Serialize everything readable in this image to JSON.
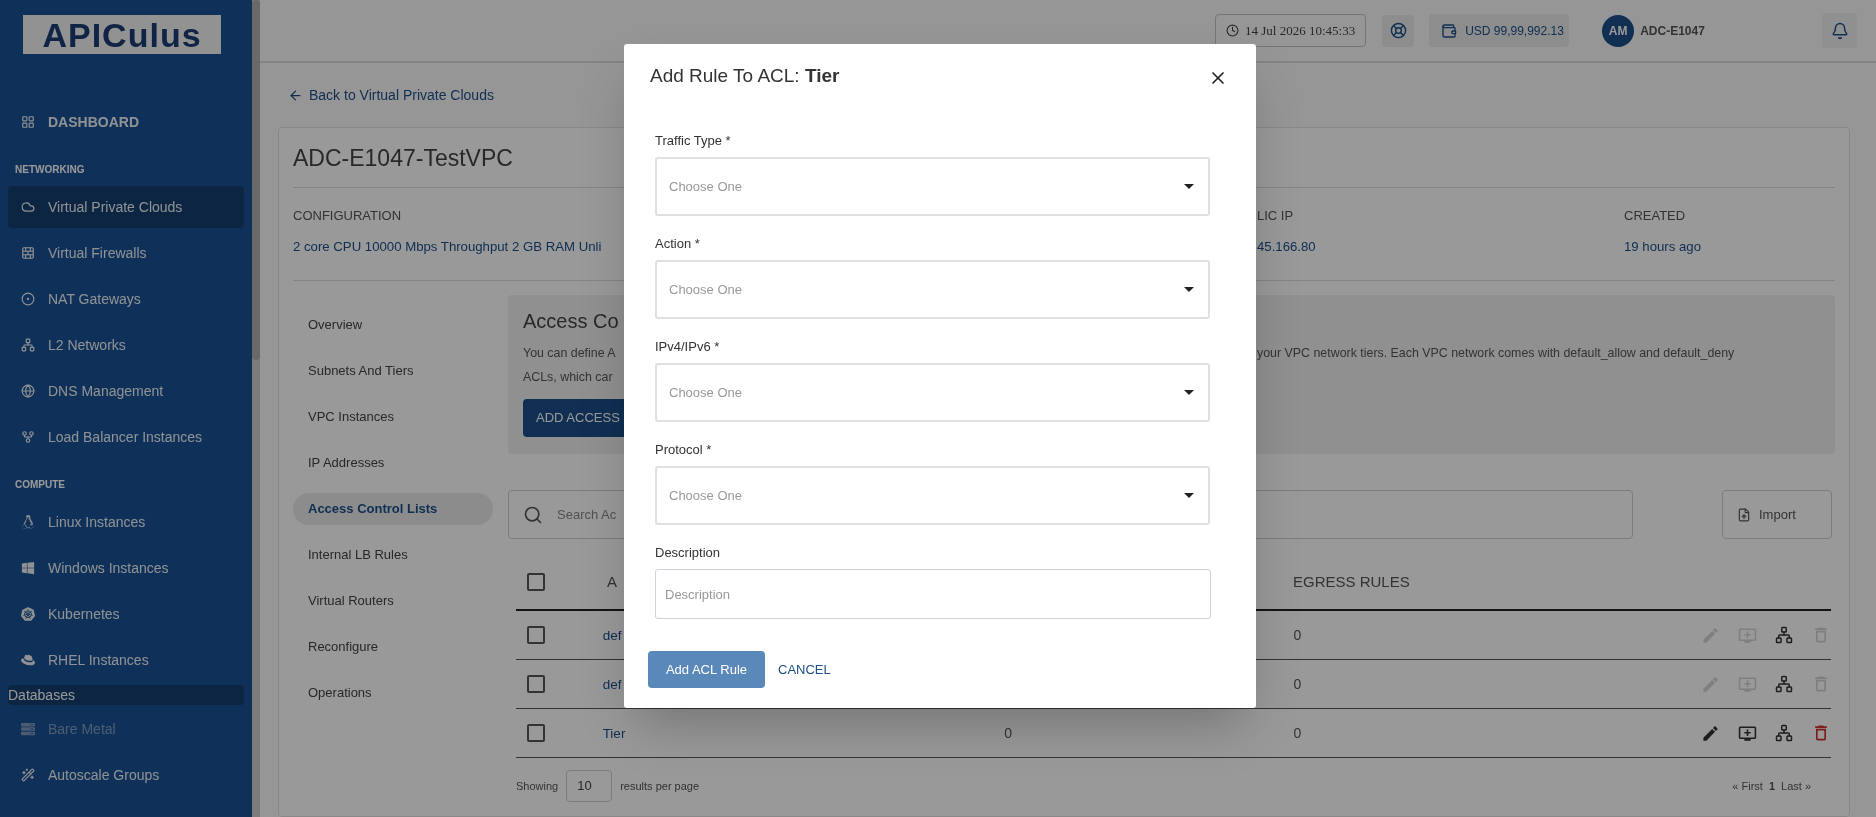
{
  "sidebar": {
    "logo": "APICulus",
    "items": [
      {
        "kind": "dashboard",
        "label": "DASHBOARD",
        "selected": false,
        "disabled": false
      },
      {
        "kind": "heading",
        "label": "NETWORKING"
      },
      {
        "kind": "link",
        "label": "Virtual Private Clouds",
        "selected": true,
        "disabled": false
      },
      {
        "kind": "link",
        "label": "Virtual Firewalls",
        "selected": false,
        "disabled": false
      },
      {
        "kind": "link",
        "label": "NAT Gateways",
        "selected": false,
        "disabled": false
      },
      {
        "kind": "link",
        "label": "L2 Networks",
        "selected": false,
        "disabled": false
      },
      {
        "kind": "link",
        "label": "DNS Management",
        "selected": false,
        "disabled": false
      },
      {
        "kind": "link",
        "label": "Load Balancer Instances",
        "selected": false,
        "disabled": false
      },
      {
        "kind": "heading",
        "label": "COMPUTE"
      },
      {
        "kind": "link",
        "label": "Linux Instances",
        "selected": false,
        "disabled": false
      },
      {
        "kind": "link",
        "label": "Windows Instances",
        "selected": false,
        "disabled": false
      },
      {
        "kind": "link",
        "label": "Kubernetes",
        "selected": false,
        "disabled": false
      },
      {
        "kind": "link",
        "label": "RHEL Instances",
        "selected": false,
        "disabled": false
      },
      {
        "kind": "category",
        "label": "Databases"
      },
      {
        "kind": "link",
        "label": "Bare Metal",
        "selected": false,
        "disabled": true
      },
      {
        "kind": "link",
        "label": "Autoscale Groups",
        "selected": false,
        "disabled": false
      }
    ]
  },
  "topbar": {
    "datetime": "14 Jul 2026 10:45:33",
    "balance": "USD 99,99,992.13",
    "avatar_initials": "AM",
    "account": "ADC-E1047"
  },
  "back_link": "Back to Virtual Private Clouds",
  "vpc": {
    "name": "ADC-E1047-TestVPC",
    "details": [
      {
        "label": "CONFIGURATION",
        "value": "2 core CPU 10000 Mbps Throughput 2 GB RAM Unli"
      },
      {
        "label": "LIC IP",
        "value": "45.166.80"
      },
      {
        "label": "CREATED",
        "value": "19 hours ago"
      }
    ]
  },
  "section_nav": [
    {
      "label": "Overview",
      "selected": false
    },
    {
      "label": "Subnets And Tiers",
      "selected": false
    },
    {
      "label": "VPC Instances",
      "selected": false
    },
    {
      "label": "IP Addresses",
      "selected": false
    },
    {
      "label": "Access Control Lists",
      "selected": true
    },
    {
      "label": "Internal LB Rules",
      "selected": false
    },
    {
      "label": "Virtual Routers",
      "selected": false
    },
    {
      "label": "Reconfigure",
      "selected": false
    },
    {
      "label": "Operations",
      "selected": false
    }
  ],
  "acl_panel": {
    "title": "Access Co",
    "description_left": [
      "You can define A",
      "ACLs, which car"
    ],
    "description_right": "your VPC network tiers. Each VPC network comes with default_allow and default_deny",
    "add_button": "ADD ACCESS"
  },
  "search": {
    "placeholder": "Search Ac"
  },
  "import_button": "Import",
  "table": {
    "select_all_checked": false,
    "columns": [
      "A",
      "EGRESS RULES"
    ],
    "rows": [
      {
        "checked": false,
        "name": "def",
        "egress": "0",
        "disabled": true
      },
      {
        "checked": false,
        "name": "def",
        "egress": "0",
        "disabled": true
      },
      {
        "checked": false,
        "name": "Tier",
        "ingress": "0",
        "egress": "0",
        "disabled": false
      }
    ]
  },
  "pagination": {
    "showing_label": "Showing",
    "page_size": "10",
    "per_page_label": "results per page",
    "first": "« First",
    "page": "1",
    "last": "Last »"
  },
  "modal": {
    "title": "Add Rule To ACL: **Tier**",
    "fields": [
      {
        "kind": "select",
        "label": "Traffic Type *",
        "placeholder": "Choose One"
      },
      {
        "kind": "select",
        "label": "Action *",
        "placeholder": "Choose One"
      },
      {
        "kind": "select",
        "label": "IPv4/IPv6 *",
        "placeholder": "Choose One"
      },
      {
        "kind": "select",
        "label": "Protocol *",
        "placeholder": "Choose One"
      },
      {
        "kind": "text",
        "label": "Description",
        "placeholder": "Description"
      }
    ],
    "submit": "Add ACL Rule",
    "cancel": "CANCEL"
  }
}
